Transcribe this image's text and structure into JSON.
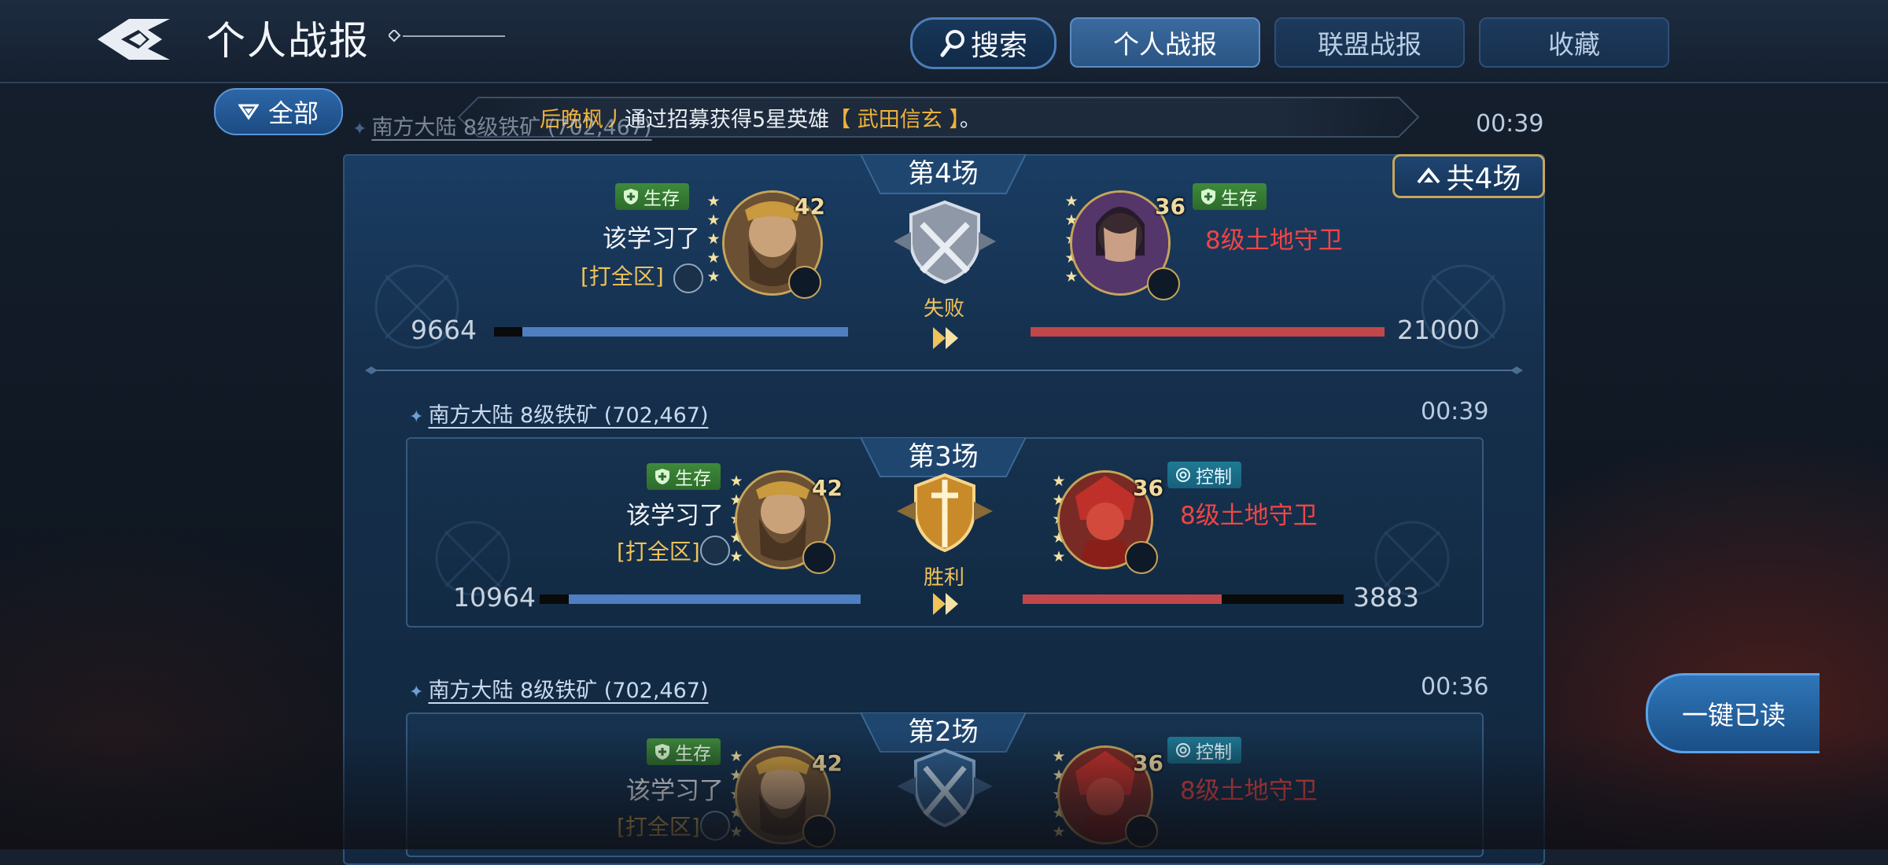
{
  "header": {
    "title": "个人战报",
    "search_label": "搜索",
    "tabs": [
      {
        "label": "个人战报",
        "active": true
      },
      {
        "label": "联盟战报",
        "active": false
      },
      {
        "label": "收藏",
        "active": false
      }
    ]
  },
  "filter": {
    "label": "全部"
  },
  "ticker": {
    "player": "后晚枫丿",
    "text": "通过招募获得5星英雄",
    "hero": "【 武田信玄 】",
    "suffix": "。"
  },
  "group": {
    "location": "南方大陆 8级铁矿 (702,467)",
    "time": "00:39",
    "total_label": "共4场"
  },
  "battles": [
    {
      "round_label": "第4场",
      "result": "失败",
      "result_type": "defeat",
      "player": {
        "name": "该学习了",
        "guild": "[打全区]",
        "level": "42",
        "tag": "生存",
        "stars": 5,
        "hp": "9664",
        "hp_fraction": 0.92
      },
      "enemy": {
        "name": "8级土地守卫",
        "level": "36",
        "tag": "生存",
        "stars": 5,
        "hp": "21000",
        "hp_fraction": 1.0
      }
    },
    {
      "location": "南方大陆 8级铁矿 (702,467)",
      "time": "00:39",
      "round_label": "第3场",
      "result": "胜利",
      "result_type": "victory",
      "player": {
        "name": "该学习了",
        "guild": "[打全区]",
        "level": "42",
        "tag": "生存",
        "stars": 5,
        "hp": "10964",
        "hp_fraction": 0.91
      },
      "enemy": {
        "name": "8级土地守卫",
        "level": "36",
        "tag": "控制",
        "stars": 5,
        "hp": "3883",
        "hp_fraction": 0.62
      }
    },
    {
      "location": "南方大陆 8级铁矿 (702,467)",
      "time": "00:36",
      "round_label": "第2场",
      "result_type": "draw",
      "player": {
        "name": "该学习了",
        "guild": "[打全区]",
        "level": "42",
        "tag": "生存",
        "stars": 5
      },
      "enemy": {
        "name": "8级土地守卫",
        "level": "36",
        "tag": "控制",
        "stars": 5
      }
    }
  ],
  "read_all_label": "一键已读",
  "colors": {
    "player_bar": "#4e7fc0",
    "enemy_bar": "#c2474a",
    "accent_gold": "#f0c25a",
    "enemy_name": "#f04545"
  }
}
